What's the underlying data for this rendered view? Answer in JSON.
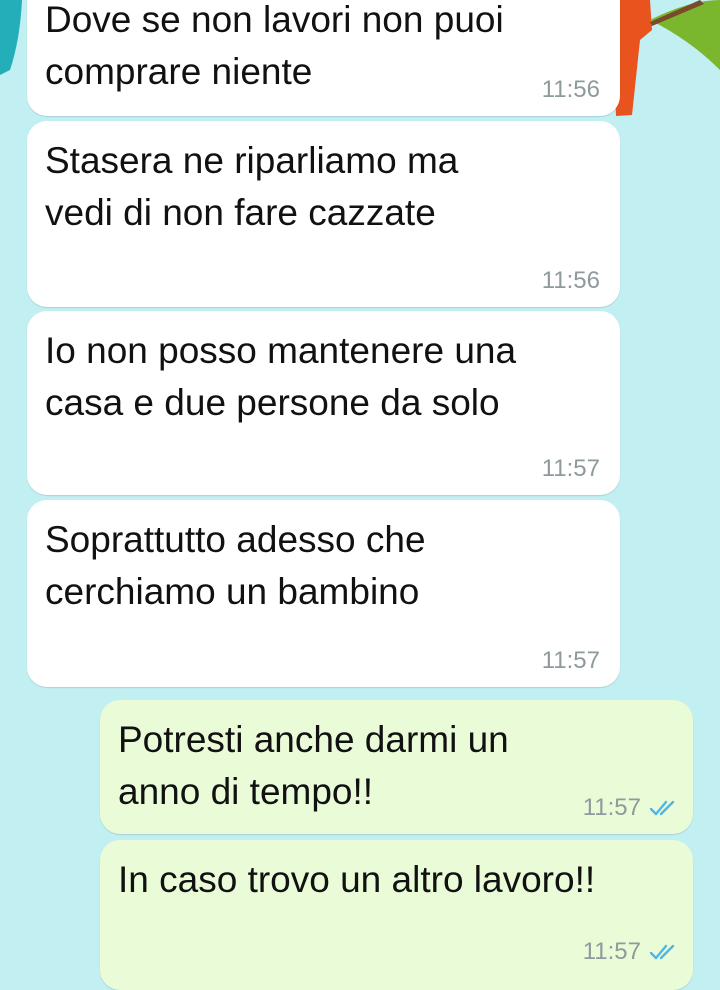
{
  "chat": {
    "messages": [
      {
        "direction": "incoming",
        "text": "Dove se non lavori non puoi\ncomprare niente",
        "time": "11:56"
      },
      {
        "direction": "incoming",
        "text": "Stasera ne riparliamo ma\nvedi di non fare cazzate",
        "time": "11:56"
      },
      {
        "direction": "incoming",
        "text": "Io non posso mantenere una\ncasa e due persone da solo",
        "time": "11:57"
      },
      {
        "direction": "incoming",
        "text": "Soprattutto adesso che\ncerchiamo un bambino",
        "time": "11:57"
      },
      {
        "direction": "outgoing",
        "text": "Potresti anche darmi un\nanno di tempo!!",
        "time": "11:57",
        "status_icon": "double-check-icon"
      },
      {
        "direction": "outgoing",
        "text": "In caso trovo un altro lavoro!!",
        "time": "11:57",
        "status_icon": "double-check-icon"
      }
    ]
  },
  "colors": {
    "background": "#c2eff2",
    "incoming_bubble": "#ffffff",
    "outgoing_bubble": "#e9fbd7",
    "read_tick": "#4fb6ec",
    "timestamp": "#8e9a9c"
  }
}
